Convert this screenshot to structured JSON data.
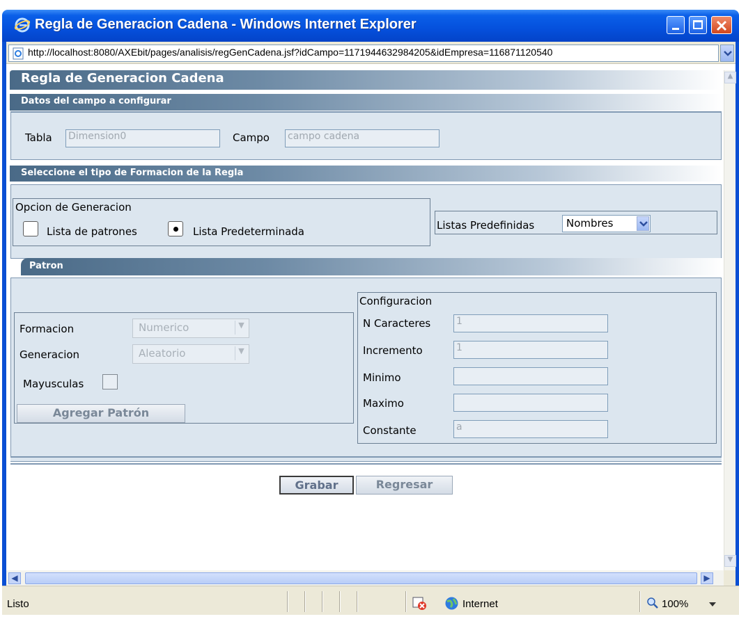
{
  "window": {
    "title": "Regla de Generacion Cadena - Windows Internet Explorer",
    "url": "http://localhost:8080/AXEbit/pages/analisis/regGenCadena.jsf?idCampo=1171944632984205&idEmpresa=116871120540"
  },
  "page": {
    "title": "Regla de Generacion Cadena",
    "datos": {
      "header": "Datos del campo a configurar",
      "tabla_label": "Tabla",
      "tabla_value": "Dimension0",
      "campo_label": "Campo",
      "campo_value": "campo cadena"
    },
    "tipo": {
      "header": "Seleccione el tipo de Formacion de la Regla",
      "group_label": "Opcion de Generacion",
      "option_patrones": "Lista de patrones",
      "option_predeterminada": "Lista Predeterminada",
      "selected": "Lista Predeterminada",
      "listas_label": "Listas Predefinidas",
      "listas_value": "Nombres"
    },
    "patron": {
      "header": "Patron",
      "formacion_label": "Formacion",
      "formacion_value": "Numerico",
      "generacion_label": "Generacion",
      "generacion_value": "Aleatorio",
      "mayusculas_label": "Mayusculas",
      "agregar_button": "Agregar Patrón",
      "config": {
        "title": "Configuracion",
        "n_caracteres_label": "N Caracteres",
        "n_caracteres_value": "1",
        "incremento_label": "Incremento",
        "incremento_value": "1",
        "minimo_label": "Minimo",
        "minimo_value": "",
        "maximo_label": "Maximo",
        "maximo_value": "",
        "constante_label": "Constante",
        "constante_value": "a"
      }
    },
    "buttons": {
      "grabar": "Grabar",
      "regresar": "Regresar"
    }
  },
  "statusbar": {
    "status": "Listo",
    "zone": "Internet",
    "zoom": "100%"
  },
  "colors": {
    "titlebar": "#0550dc",
    "header_dark": "#4a6a87",
    "panel_bg": "#dce6ef",
    "panel_border": "#7f98b2"
  }
}
